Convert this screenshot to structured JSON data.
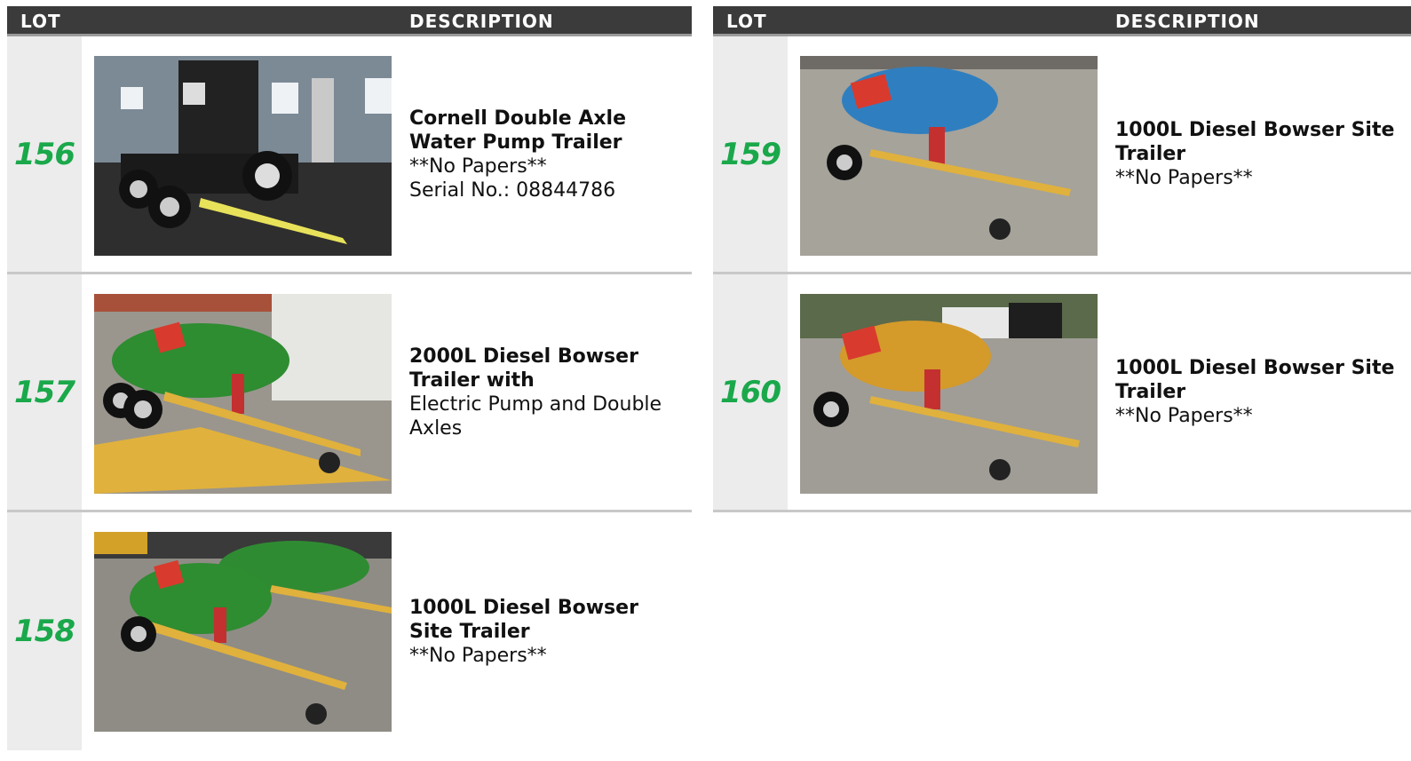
{
  "columns": {
    "lot": "LOT",
    "description": "DESCRIPTION"
  },
  "lots": [
    {
      "number": "156",
      "title": "Cornell Double Axle Water Pump Trailer",
      "lines": [
        "**No Papers**",
        "Serial No.: 08844786"
      ],
      "image": "water-pump-trailer-photo"
    },
    {
      "number": "157",
      "title": "2000L Diesel Bowser Trailer with",
      "lines": [
        "Electric Pump and Double Axles",
        ""
      ],
      "image": "green-diesel-bowser-photo"
    },
    {
      "number": "158",
      "title": "1000L Diesel Bowser Site Trailer",
      "lines": [
        "**No Papers**",
        ""
      ],
      "image": "green-site-bowser-photo"
    },
    {
      "number": "159",
      "title": "1000L Diesel Bowser Site Trailer",
      "lines": [
        "**No Papers**",
        ""
      ],
      "image": "blue-diesel-bowser-photo"
    },
    {
      "number": "160",
      "title": "1000L Diesel Bowser Site Trailer",
      "lines": [
        "**No Papers**",
        ""
      ],
      "image": "yellow-diesel-bowser-photo"
    }
  ],
  "colors": {
    "header": "#3b3b3b",
    "lot_number": "#1aa84b",
    "lot_cell": "#ececec"
  }
}
